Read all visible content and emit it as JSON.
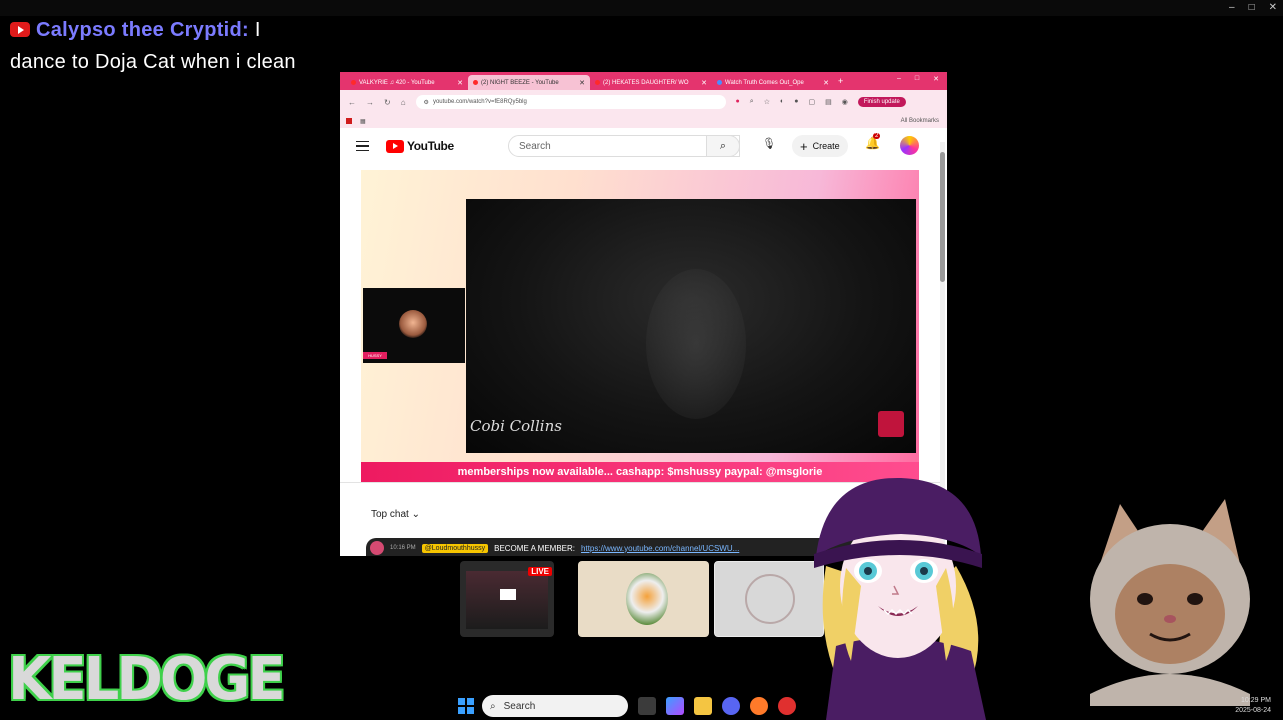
{
  "window": {
    "controls": [
      "–",
      "□",
      "✕"
    ]
  },
  "chat_message": {
    "username": "Calypso thee Cryptid:",
    "text": "I dance to Doja Cat when i clean"
  },
  "browser": {
    "tabs": [
      {
        "label": "VALKYRIE ♫ 420 - YouTube",
        "active": false
      },
      {
        "label": "(2) NIGHT BEEZE - YouTube",
        "active": true
      },
      {
        "label": "(2) HEKATES DAUGHTER/ WO",
        "active": false
      },
      {
        "label": "Watch Truth Comes Out_Ope",
        "active": false
      }
    ],
    "new_tab": "+",
    "url": "youtube.com/watch?v=fE8RQy5blg",
    "finish_update": "Finish update",
    "all_bookmarks": "All Bookmarks"
  },
  "youtube": {
    "logo": "YouTube",
    "search_placeholder": "Search",
    "create_label": "Create",
    "notification_count": "2",
    "cam_tag": "HUSSY",
    "video_watermark": "Cobi Collins",
    "banner_text": "memberships now available... cashapp: $mshussy paypal: @msglorie",
    "chat_mode": "Top chat",
    "pinned_message": {
      "time": "10:16 PM",
      "user": "@Loudmouthhussy",
      "text": "BECOME A MEMBER:",
      "link": "https://www.youtube.com/channel/UCSWU..."
    }
  },
  "thumbnails": {
    "live_label": "LIVE"
  },
  "overlay_logo": "KELDOGE",
  "taskbar": {
    "search_label": "Search",
    "time": "10:29 PM",
    "date": "2025-08-24"
  },
  "colors": {
    "chat_username": "#7b7bff",
    "browser_accent": "#e4346e",
    "keldoge_outline": "#3fd14b",
    "youtube_red": "#ff0000"
  }
}
